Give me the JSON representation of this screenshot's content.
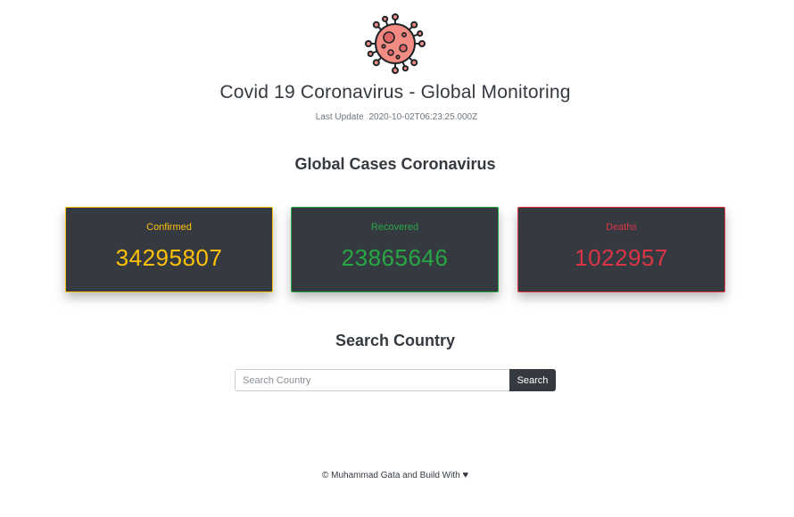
{
  "header": {
    "title": "Covid 19 Coronavirus - Global Monitoring",
    "last_update_label": "Last Update",
    "last_update_value": "2020-10-02T06:23:25.000Z",
    "logo_icon": "virus-icon"
  },
  "global": {
    "title": "Global Cases Coronavirus",
    "cards": [
      {
        "label": "Confirmed",
        "value": "34295807",
        "color": "#ffc107"
      },
      {
        "label": "Recovered",
        "value": "23865646",
        "color": "#28a745"
      },
      {
        "label": "Deaths",
        "value": "1022957",
        "color": "#dc3545"
      }
    ]
  },
  "search": {
    "title": "Search Country",
    "placeholder": "Search Country",
    "value": "",
    "button_label": "Search"
  },
  "footer": {
    "text": "© Muhammad Gata and Build With",
    "heart": "♥"
  },
  "colors": {
    "card_background": "#343a40",
    "virus": "#f08080"
  }
}
